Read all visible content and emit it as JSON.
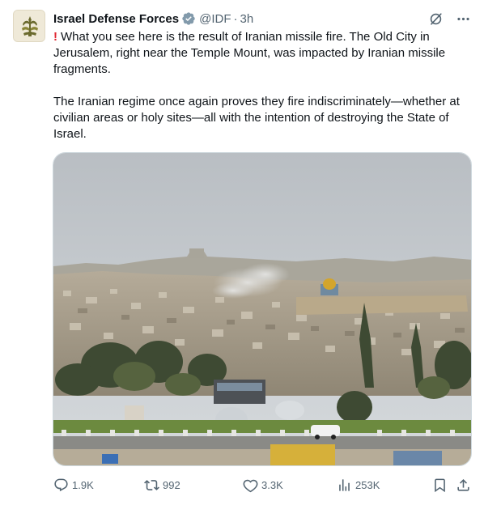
{
  "account": {
    "name": "Israel Defense Forces",
    "handle": "@IDF",
    "time": "3h",
    "separator": "·"
  },
  "post": {
    "paragraph1_icon": "!",
    "paragraph1": "What you see here is the result of Iranian missile fire. The Old City in Jerusalem, right near the Temple Mount, was impacted by Iranian missile fragments.",
    "paragraph2": "The Iranian regime once again proves they fire indiscriminately—whether at civilian areas or holy sites—all with the intention of destroying the State of Israel."
  },
  "actions": {
    "replies": "1.9K",
    "reposts": "992",
    "likes": "3.3K",
    "views": "253K"
  },
  "icons": {
    "verified": "verified-badge-icon",
    "grok": "grok-icon",
    "more": "more-icon",
    "reply": "reply-icon",
    "repost": "repost-icon",
    "like": "heart-icon",
    "views": "views-chart-icon",
    "bookmark": "bookmark-icon",
    "share": "share-icon"
  },
  "colors": {
    "text": "#0f1419",
    "secondary": "#536471",
    "verified": "#829aab",
    "alert": "#e0242f",
    "border": "#cfd9de"
  }
}
